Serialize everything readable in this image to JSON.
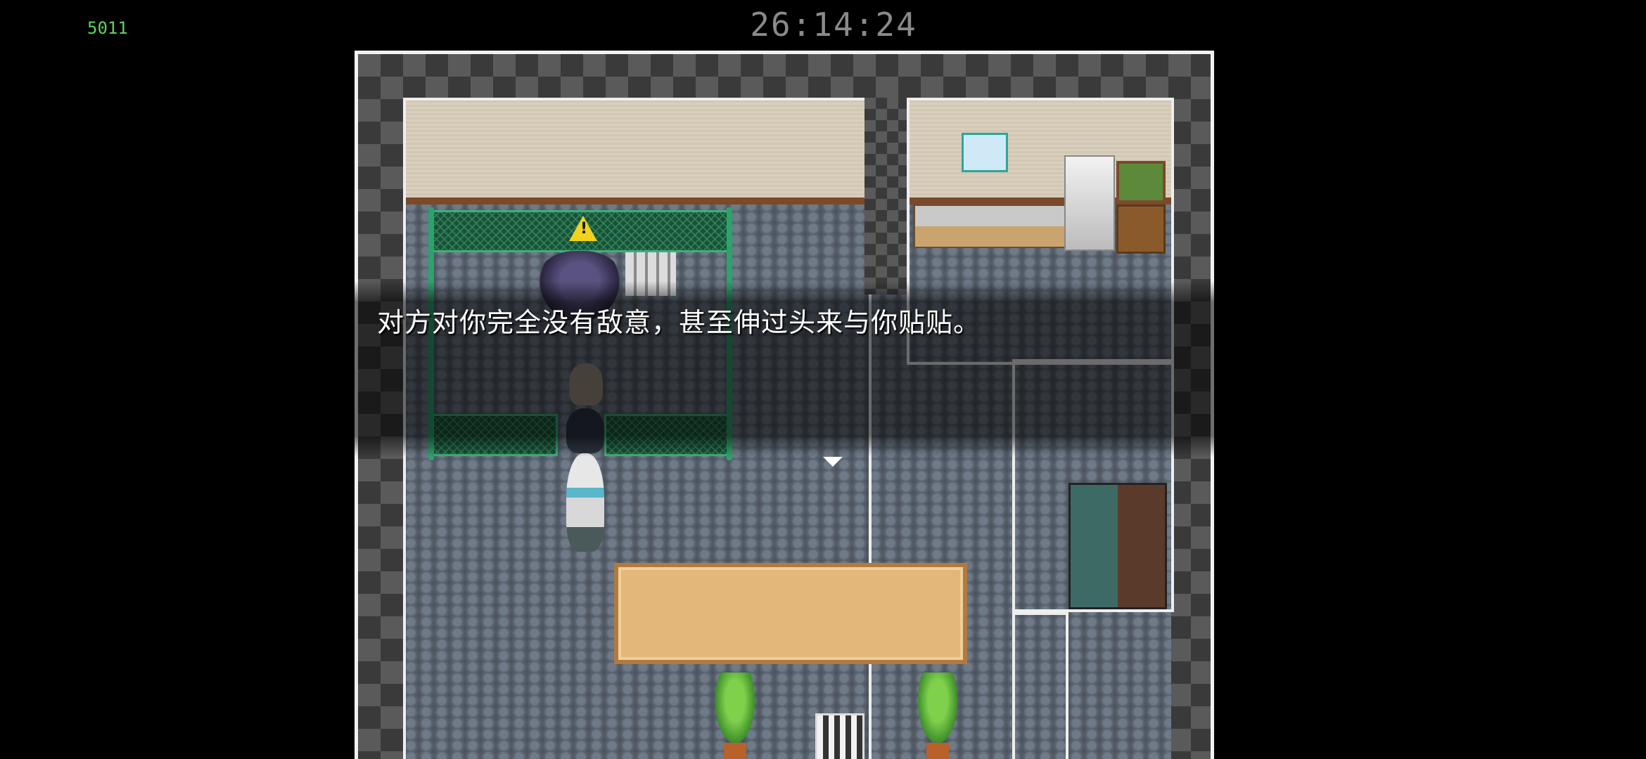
{
  "hud": {
    "fps": "5011",
    "timer": "26:14:24"
  },
  "dialog": {
    "message": "对方对你完全没有敌意，甚至伸过头来与你贴贴。"
  },
  "colors": {
    "fps": "#5fd35f",
    "timer": "#8a8a8a",
    "dialog_text": "#ffffff",
    "fence": "#3fae7a"
  },
  "icons": {
    "warning": "warning-triangle-icon",
    "continue": "continue-arrow-icon"
  }
}
